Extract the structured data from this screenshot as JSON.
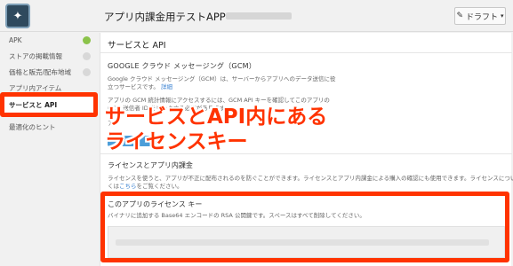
{
  "header": {
    "app_icon_glyph": "✦",
    "title": "アプリ内課金用テストAPP -",
    "draft_label": "ドラフト",
    "draft_icon": "pencil-icon",
    "chevron_icon": "chevron-down-icon"
  },
  "sidebar": {
    "items": [
      {
        "label": "APK",
        "status": "complete"
      },
      {
        "label": "ストアの掲載情報",
        "status": "incomplete"
      },
      {
        "label": "価格と販売/配布地域",
        "status": "incomplete"
      },
      {
        "label": "アプリ内アイテム",
        "status": "none"
      },
      {
        "label": "サービスと API",
        "status": "active"
      },
      {
        "label": "最適化のヒント",
        "status": "none"
      }
    ]
  },
  "main": {
    "section_title": "サービスと API",
    "gcm": {
      "title": "GOOGLE クラウド メッセージング（GCM）",
      "desc_line1": "Google クラウド メッセージング（GCM）は、サーバーからアプリへのデータ送信に役",
      "desc_line2": "立つサービスです。",
      "desc_link": "詳細",
      "desc_line3": "アプリの GCM 統計情報にアクセスするには、GCM API キーを確認してこのアプリの",
      "desc_line4": "GCM 送信者 ID をリンクする必要があります。",
      "desc_line5": "ア"
    },
    "license": {
      "title": "ライセンスとアプリ内課金",
      "desc_line1": "ライセンスを使うと、アプリが不正に配布されるのを防ぐことができます。ライセンスとアプリ内課金による購入の確認にも使用できます。ライセンスについて詳し",
      "desc_line2": "くは",
      "desc_link": "こちら",
      "desc_line3": "をご覧ください。"
    },
    "key": {
      "title": "このアプリのライセンス キー",
      "desc": "バイナリに追加する Base64 エンコードの RSA 公開鍵です。スペースはすべて削除してください。"
    }
  },
  "overlay": {
    "line1": "サービスとAPI内にある",
    "line2": "ライセンスキー"
  },
  "colors": {
    "highlight": "#ff3300",
    "check_green": "#8bc34a",
    "link": "#3a82d2"
  }
}
